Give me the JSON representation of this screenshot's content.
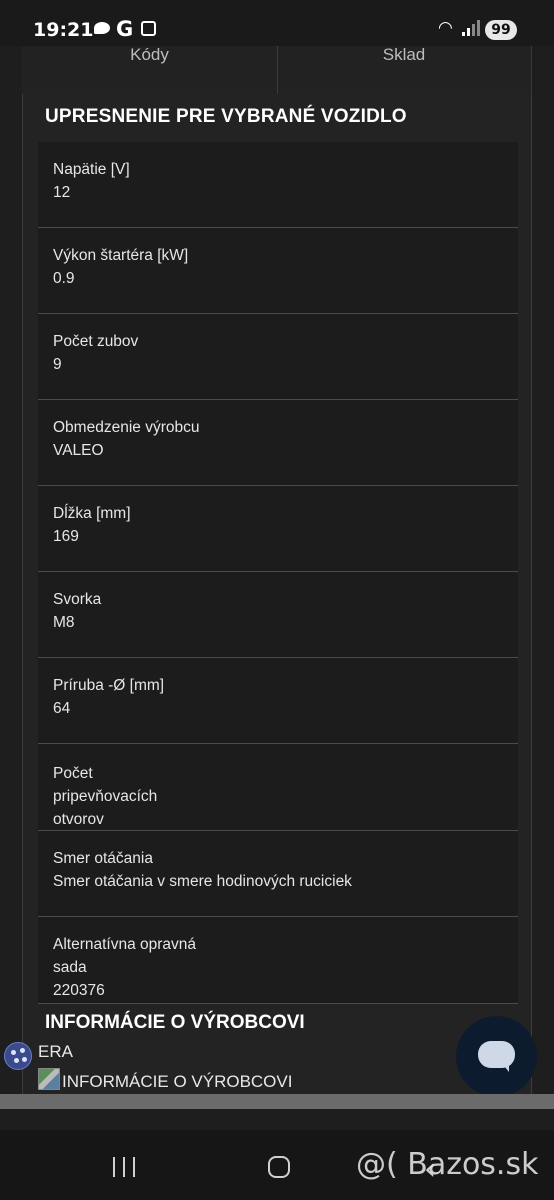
{
  "status_bar": {
    "time": "19:21",
    "carrier_glyph": "G",
    "battery": "99",
    "icons": [
      "chat-icon",
      "screenshot-icon",
      "wifi-icon",
      "signal-icon",
      "battery-icon"
    ]
  },
  "tabs": [
    {
      "label": "Kódy"
    },
    {
      "label": "Sklad"
    }
  ],
  "specs": {
    "title": "UPRESNENIE PRE VYBRANÉ VOZIDLO",
    "rows": [
      {
        "label": "Napätie [V]",
        "value": "12"
      },
      {
        "label": "Výkon štartéra [kW]",
        "value": "0.9"
      },
      {
        "label": "Počet zubov",
        "value": "9"
      },
      {
        "label": "Obmedzenie výrobcu",
        "value": "VALEO"
      },
      {
        "label": "Dĺžka [mm]",
        "value": "169"
      },
      {
        "label": "Svorka",
        "value": "M8"
      },
      {
        "label": "Príruba -Ø [mm]",
        "value": "64"
      },
      {
        "label": "Počet pripevňovacích otvorov",
        "value": ""
      },
      {
        "label": "Smer otáčania",
        "value": "Smer otáčania v smere hodinových ruciciek"
      },
      {
        "label": "Alternatívna opravná sada",
        "value": "220376"
      }
    ]
  },
  "manufacturer": {
    "title": "INFORMÁCIE O VÝROBCOVI",
    "name": "ERA",
    "image_alt": "INFORMÁCIE O VÝROBCOVI"
  },
  "watermark": "@( Bazos.sk",
  "colors": {
    "background": "#1e1e1e",
    "row_bg": "#1c1c1c",
    "divider": "#4a4a4a",
    "fab": "#0d1b2e"
  }
}
